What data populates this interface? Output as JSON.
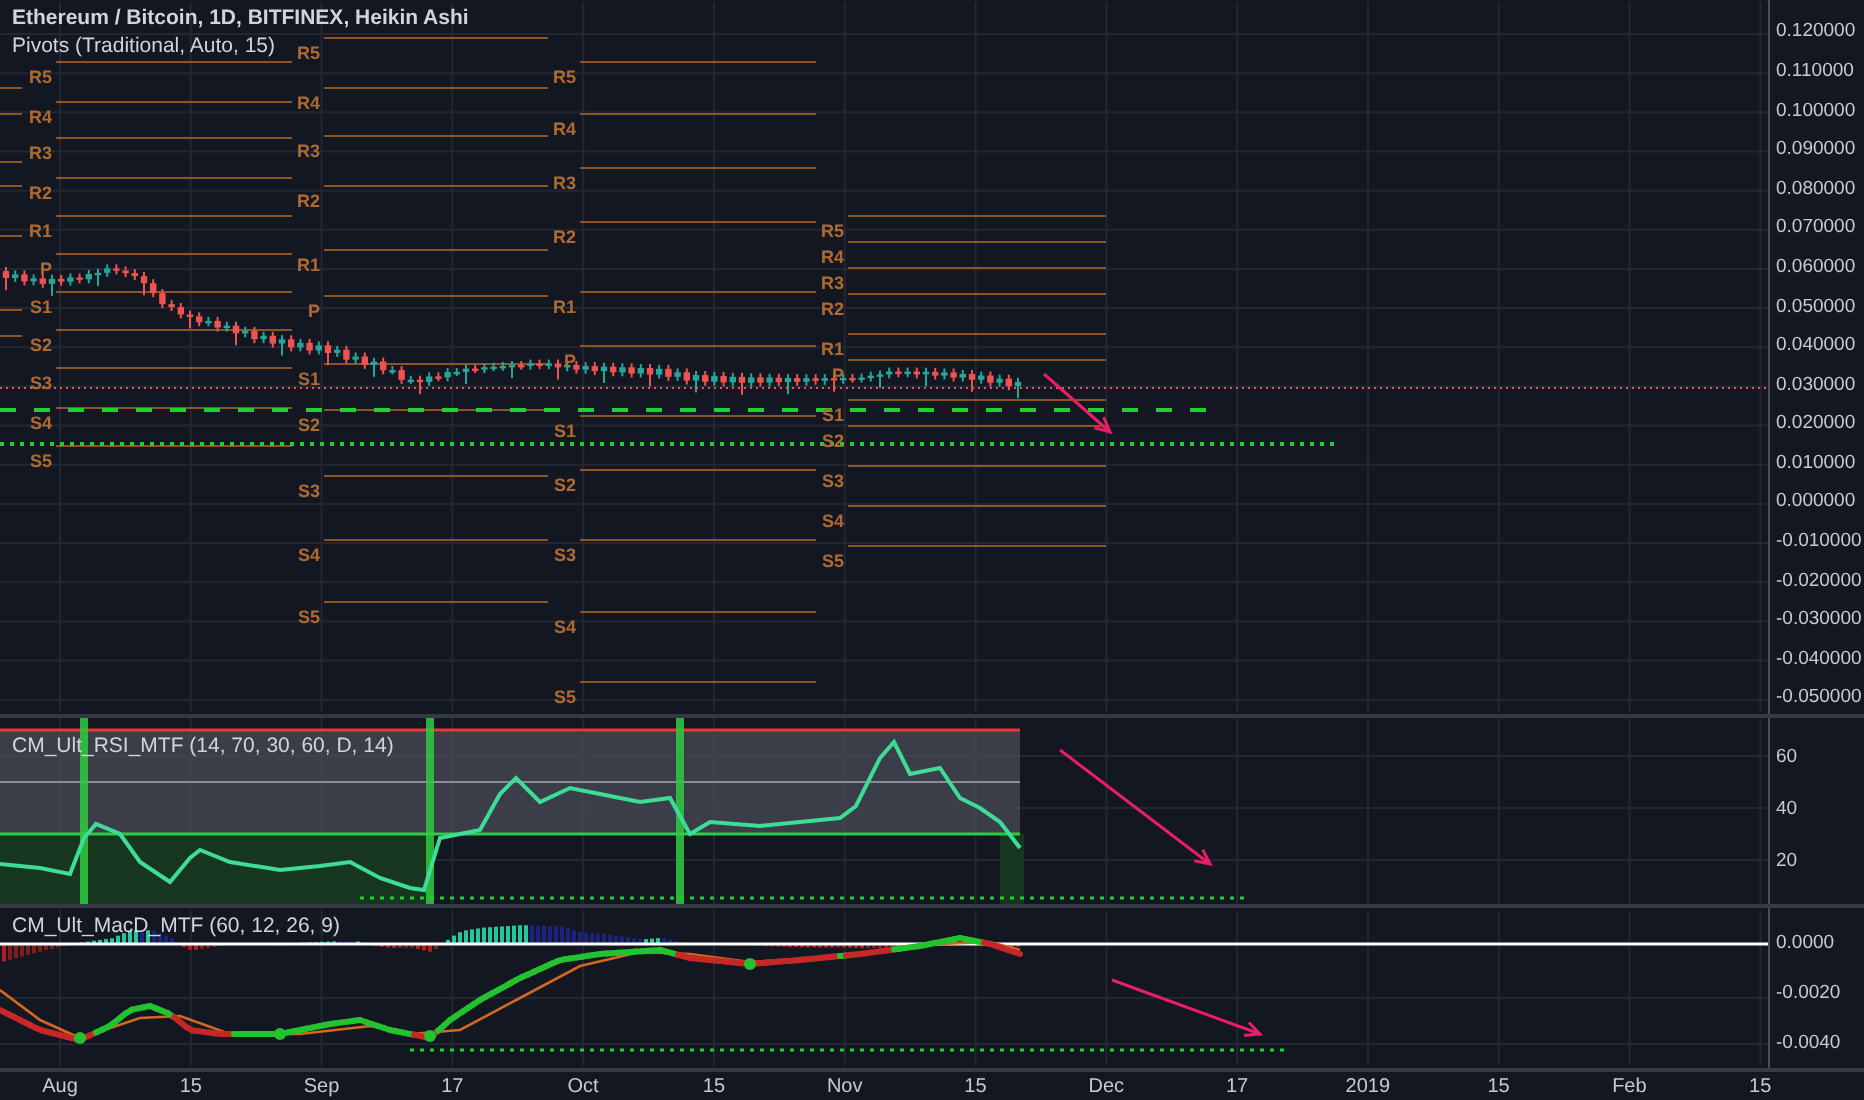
{
  "chart": {
    "title": "Ethereum / Bitcoin, 1D, BITFINEX, Heikin Ashi",
    "indicator": "Pivots (Traditional, Auto, 15)",
    "pivot_periods": [
      {
        "labels": [
          "R5",
          "R4",
          "R3",
          "R2",
          "R1",
          "P",
          "S1",
          "S2",
          "S3",
          "S4",
          "S5"
        ]
      },
      {
        "labels": [
          "R5",
          "R4",
          "R3",
          "R2",
          "R1",
          "P",
          "S1",
          "S2",
          "S3",
          "S4",
          "S5"
        ]
      },
      {
        "labels": [
          "R5",
          "R4",
          "R3",
          "R2",
          "R1",
          "P",
          "S1",
          "S2",
          "S3",
          "S4",
          "S5"
        ]
      },
      {
        "labels": [
          "R5",
          "R4",
          "R3",
          "R2",
          "R1",
          "P",
          "S1",
          "S2",
          "S3",
          "S4",
          "S5"
        ]
      }
    ]
  },
  "price_axis": [
    "0.120000",
    "0.110000",
    "0.100000",
    "0.090000",
    "0.080000",
    "0.070000",
    "0.060000",
    "0.050000",
    "0.040000",
    "0.030000",
    "0.020000",
    "0.010000",
    "0.000000",
    "-0.010000",
    "-0.020000",
    "-0.030000",
    "-0.040000",
    "-0.050000"
  ],
  "rsi_pane": {
    "title": "CM_Ult_RSI_MTF (14, 70, 30, 60, D, 14)",
    "axis": [
      "60",
      "40",
      "20"
    ]
  },
  "macd_pane": {
    "title": "CM_Ult_MacD_MTF (60, 12, 26, 9)",
    "axis": [
      "0.0000",
      "-0.0020",
      "-0.0040"
    ]
  },
  "time_axis": [
    "Aug",
    "15",
    "Sep",
    "17",
    "Oct",
    "15",
    "Nov",
    "15",
    "Dec",
    "17",
    "2019",
    "15",
    "Feb",
    "15"
  ]
}
